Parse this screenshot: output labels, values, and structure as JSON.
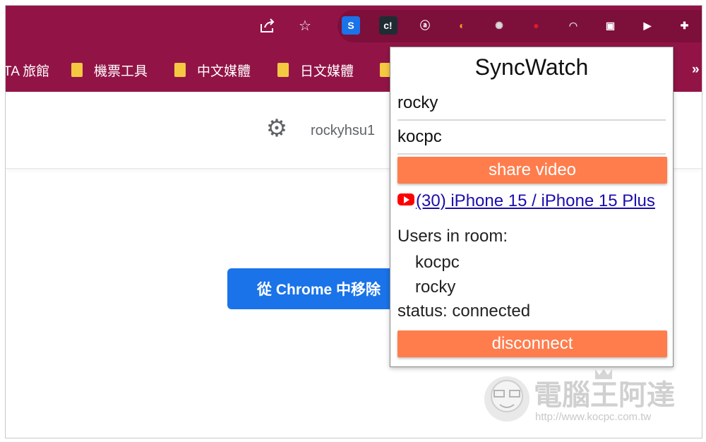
{
  "toolbar": {
    "share_icon": "share-icon",
    "star_icon": "star-icon",
    "extensions": [
      {
        "name": "s-extension-icon",
        "glyph": "S",
        "bg": "#1a73e8",
        "fg": "#ffffff"
      },
      {
        "name": "ct-extension-icon",
        "glyph": "c!",
        "bg": "#1f2d33",
        "fg": "#ffffff"
      },
      {
        "name": "at-extension-icon",
        "glyph": "ⓐ",
        "bg": "transparent",
        "fg": "#ffffff"
      },
      {
        "name": "orange-extension-icon",
        "glyph": "◐",
        "bg": "transparent",
        "fg": "#ff9a1f"
      },
      {
        "name": "spider-extension-icon",
        "glyph": "✺",
        "bg": "transparent",
        "fg": "#d9d9d9"
      },
      {
        "name": "red-dot-extension-icon",
        "glyph": "●",
        "bg": "transparent",
        "fg": "#e01b24"
      },
      {
        "name": "arc-extension-icon",
        "glyph": "◠",
        "bg": "transparent",
        "fg": "#cfcfcf"
      },
      {
        "name": "bus-extension-icon",
        "glyph": "▣",
        "bg": "transparent",
        "fg": "#ffffff"
      },
      {
        "name": "syncwatch-extension-icon",
        "glyph": "▶",
        "bg": "transparent",
        "fg": "#ffffff"
      },
      {
        "name": "puzzle-extension-icon",
        "glyph": "✚",
        "bg": "transparent",
        "fg": "#ffffff"
      }
    ]
  },
  "bookmarks": {
    "items": [
      {
        "label": "TA 旅館"
      },
      {
        "label": "機票工具"
      },
      {
        "label": "中文媒體"
      },
      {
        "label": "日文媒體"
      }
    ],
    "more": "»"
  },
  "page": {
    "account": "rockyhsu1",
    "remove_button": "從 Chrome 中移除"
  },
  "popup": {
    "title": "SyncWatch",
    "name_value": "rocky",
    "room_value": "kocpc",
    "share_label": "share video",
    "video_link": "(30) iPhone 15 / iPhone 15 Plus",
    "users_heading": "Users in room:",
    "users": [
      "kocpc",
      "rocky"
    ],
    "status": "status: connected",
    "disconnect_label": "disconnect"
  },
  "watermark": {
    "brand": "電腦王阿達",
    "url": "http://www.kocpc.com.tw"
  }
}
